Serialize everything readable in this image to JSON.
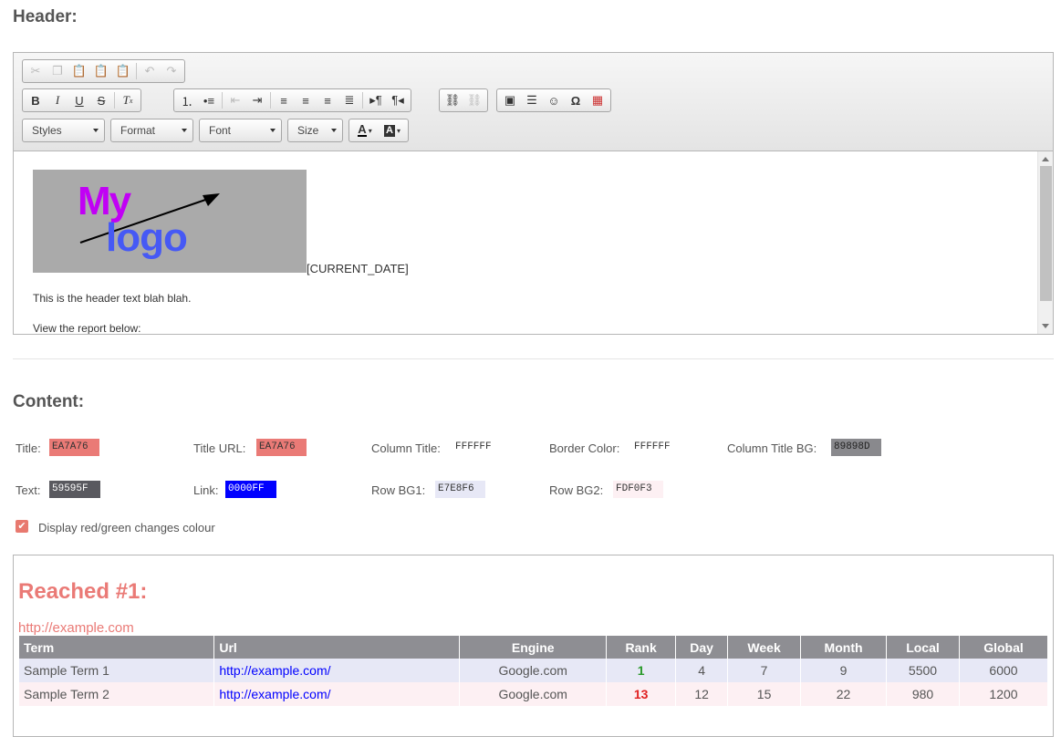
{
  "header": {
    "title": "Header:",
    "toolbar": {
      "row1": [
        "cut-icon",
        "copy-icon",
        "paste-icon",
        "paste-text-icon",
        "paste-word-icon",
        "undo-icon",
        "redo-icon"
      ],
      "styles": "Styles",
      "format": "Format",
      "font": "Font",
      "size": "Size"
    },
    "editor": {
      "logo_line1": "My",
      "logo_line2": "logo",
      "date_token": "[CURRENT_DATE]",
      "line1": "This is the header text blah blah.",
      "line2": "View the report below:"
    }
  },
  "content": {
    "title": "Content:",
    "fields": [
      {
        "label": "Title:",
        "value": "EA7A76",
        "bg": "#EA7A76",
        "fg": "#333333"
      },
      {
        "label": "Title URL:",
        "value": "EA7A76",
        "bg": "#EA7A76",
        "fg": "#333333"
      },
      {
        "label": "Column Title:",
        "value": "FFFFFF",
        "bg": "#FFFFFF",
        "fg": "#333333"
      },
      {
        "label": "Border Color:",
        "value": "FFFFFF",
        "bg": "#FFFFFF",
        "fg": "#333333"
      },
      {
        "label": "Column Title BG:",
        "value": "89898D",
        "bg": "#89898D",
        "fg": "#222222"
      },
      {
        "label": "Text:",
        "value": "59595F",
        "bg": "#59595F",
        "fg": "#FFFFFF"
      },
      {
        "label": "Link:",
        "value": "0000FF",
        "bg": "#0000FF",
        "fg": "#FFFFFF"
      },
      {
        "label": "Row BG1:",
        "value": "E7E8F6",
        "bg": "#E7E8F6",
        "fg": "#333333"
      },
      {
        "label": "Row BG2:",
        "value": "FDF0F3",
        "bg": "#FDF0F3",
        "fg": "#333333"
      }
    ],
    "checkbox_label": "Display red/green changes colour"
  },
  "preview": {
    "title": "Reached #1:",
    "url": "http://example.com",
    "columns": [
      "Term",
      "Url",
      "Engine",
      "Rank",
      "Day",
      "Week",
      "Month",
      "Local",
      "Global"
    ],
    "rows": [
      {
        "term": "Sample Term 1",
        "url": "http://example.com/",
        "engine": "Google.com",
        "rank": "1",
        "day": "4",
        "week": "7",
        "month": "9",
        "local": "5500",
        "global": "6000"
      },
      {
        "term": "Sample Term 2",
        "url": "http://example.com/",
        "engine": "Google.com",
        "rank": "13",
        "day": "12",
        "week": "15",
        "month": "22",
        "local": "980",
        "global": "1200"
      }
    ]
  }
}
